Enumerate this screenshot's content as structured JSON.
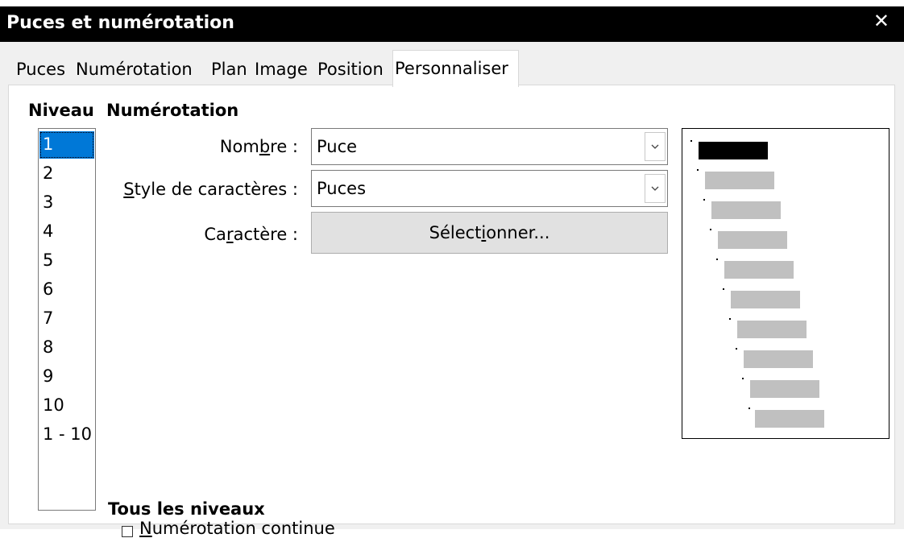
{
  "window": {
    "title": "Puces et numérotation",
    "close_glyph": "✕"
  },
  "tabs": [
    {
      "label": "Puces"
    },
    {
      "label": "Numérotation"
    },
    {
      "label": "Plan"
    },
    {
      "label": "Image"
    },
    {
      "label": "Position"
    },
    {
      "label": "Personnaliser",
      "active": true
    }
  ],
  "level_section": {
    "heading": "Niveau",
    "items": [
      "1",
      "2",
      "3",
      "4",
      "5",
      "6",
      "7",
      "8",
      "9",
      "10",
      "1 - 10"
    ],
    "selected": "1"
  },
  "numbering": {
    "heading": "Numérotation",
    "number_label_pre": "Nom",
    "number_label_acc": "b",
    "number_label_post": "re :",
    "number_value": "Puce",
    "style_label_acc": "S",
    "style_label_post": "tyle de caractères :",
    "style_value": "Puces",
    "char_label_pre": "Ca",
    "char_label_acc": "r",
    "char_label_post": "actère :",
    "select_pre": "Sélect",
    "select_acc": "i",
    "select_post": "onner..."
  },
  "all_levels": {
    "heading": "Tous les niveaux",
    "continuous_acc": "N",
    "continuous_post": "umérotation continue",
    "continuous_checked": false
  },
  "colors": {
    "accent": "#0078d7",
    "titlebar": "#000000",
    "preview_bar": "#c0c0c0"
  }
}
